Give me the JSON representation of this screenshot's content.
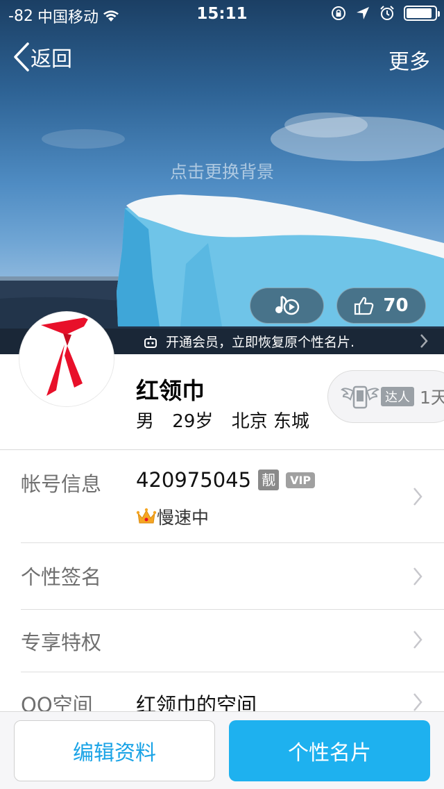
{
  "status_bar": {
    "signal": "-82",
    "carrier": "中国移动",
    "time": "15:11",
    "icons": [
      "wifi-icon",
      "rotation-lock-icon",
      "location-icon",
      "alarm-icon",
      "battery-icon"
    ]
  },
  "nav": {
    "back_label": "返回",
    "more_label": "更多"
  },
  "hero": {
    "change_background": "点击更换背景",
    "music_icon": "music-play-icon",
    "likes": "70",
    "vip_banner": "开通会员，立即恢复原个性名片."
  },
  "profile": {
    "name": "红领巾",
    "gender": "男",
    "age": "29岁",
    "location": "北京 东城",
    "expert_tag": "达人",
    "expert_days": "1天"
  },
  "rows": {
    "account": {
      "label": "帐号信息",
      "qq_number": "420975045",
      "liang_badge": "靓",
      "vip_badge": "VIP",
      "status": "慢速中"
    },
    "signature": {
      "label": "个性签名"
    },
    "privilege": {
      "label": "专享特权"
    },
    "qzone": {
      "label": "QQ空间",
      "value": "红领巾的空间"
    }
  },
  "toolbar": {
    "edit_label": "编辑资料",
    "card_label": "个性名片"
  },
  "colors": {
    "accent": "#1eb1ef",
    "accent_text": "#19a3e6",
    "label_gray": "#6f6f6f"
  }
}
